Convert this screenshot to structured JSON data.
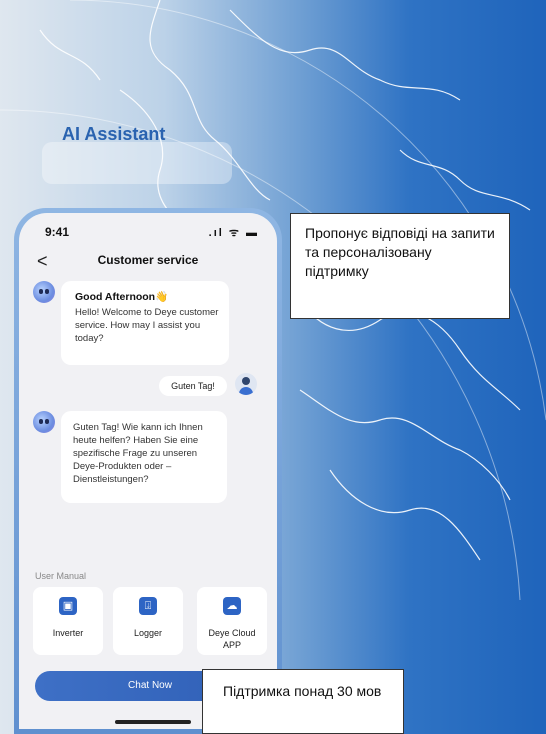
{
  "ai_title": "AI Assistant",
  "phone": {
    "time": "9:41",
    "status_icons": ".ıl ᯤ ▬",
    "nav": {
      "back": "<",
      "title": "Customer service"
    },
    "messages": [
      {
        "greeting": "Good Afternoon👋",
        "text": "Hello! Welcome to Deye customer service. How may I assist you today?"
      },
      {
        "text": "Guten Tag!"
      },
      {
        "text": "Guten Tag! Wie kann ich Ihnen heute helfen? Haben Sie eine spezifische Frage zu unseren Deye-Produkten oder – Dienstleistungen?"
      }
    ],
    "manual_label": "User Manual",
    "cards": [
      {
        "label": "Inverter",
        "icon": "inverter-icon"
      },
      {
        "label": "Logger",
        "icon": "logger-icon"
      },
      {
        "label": "Deye Cloud APP",
        "icon": "cloud-app-icon"
      }
    ],
    "chat_button": "Chat Now"
  },
  "callouts": {
    "suggest": "Пропонує відповіді на запити та персоналізовану підтримку",
    "languages": "Підтримка понад 30 мов"
  },
  "colors": {
    "accent": "#2f5fb6",
    "background_right": "#1f64bb"
  }
}
